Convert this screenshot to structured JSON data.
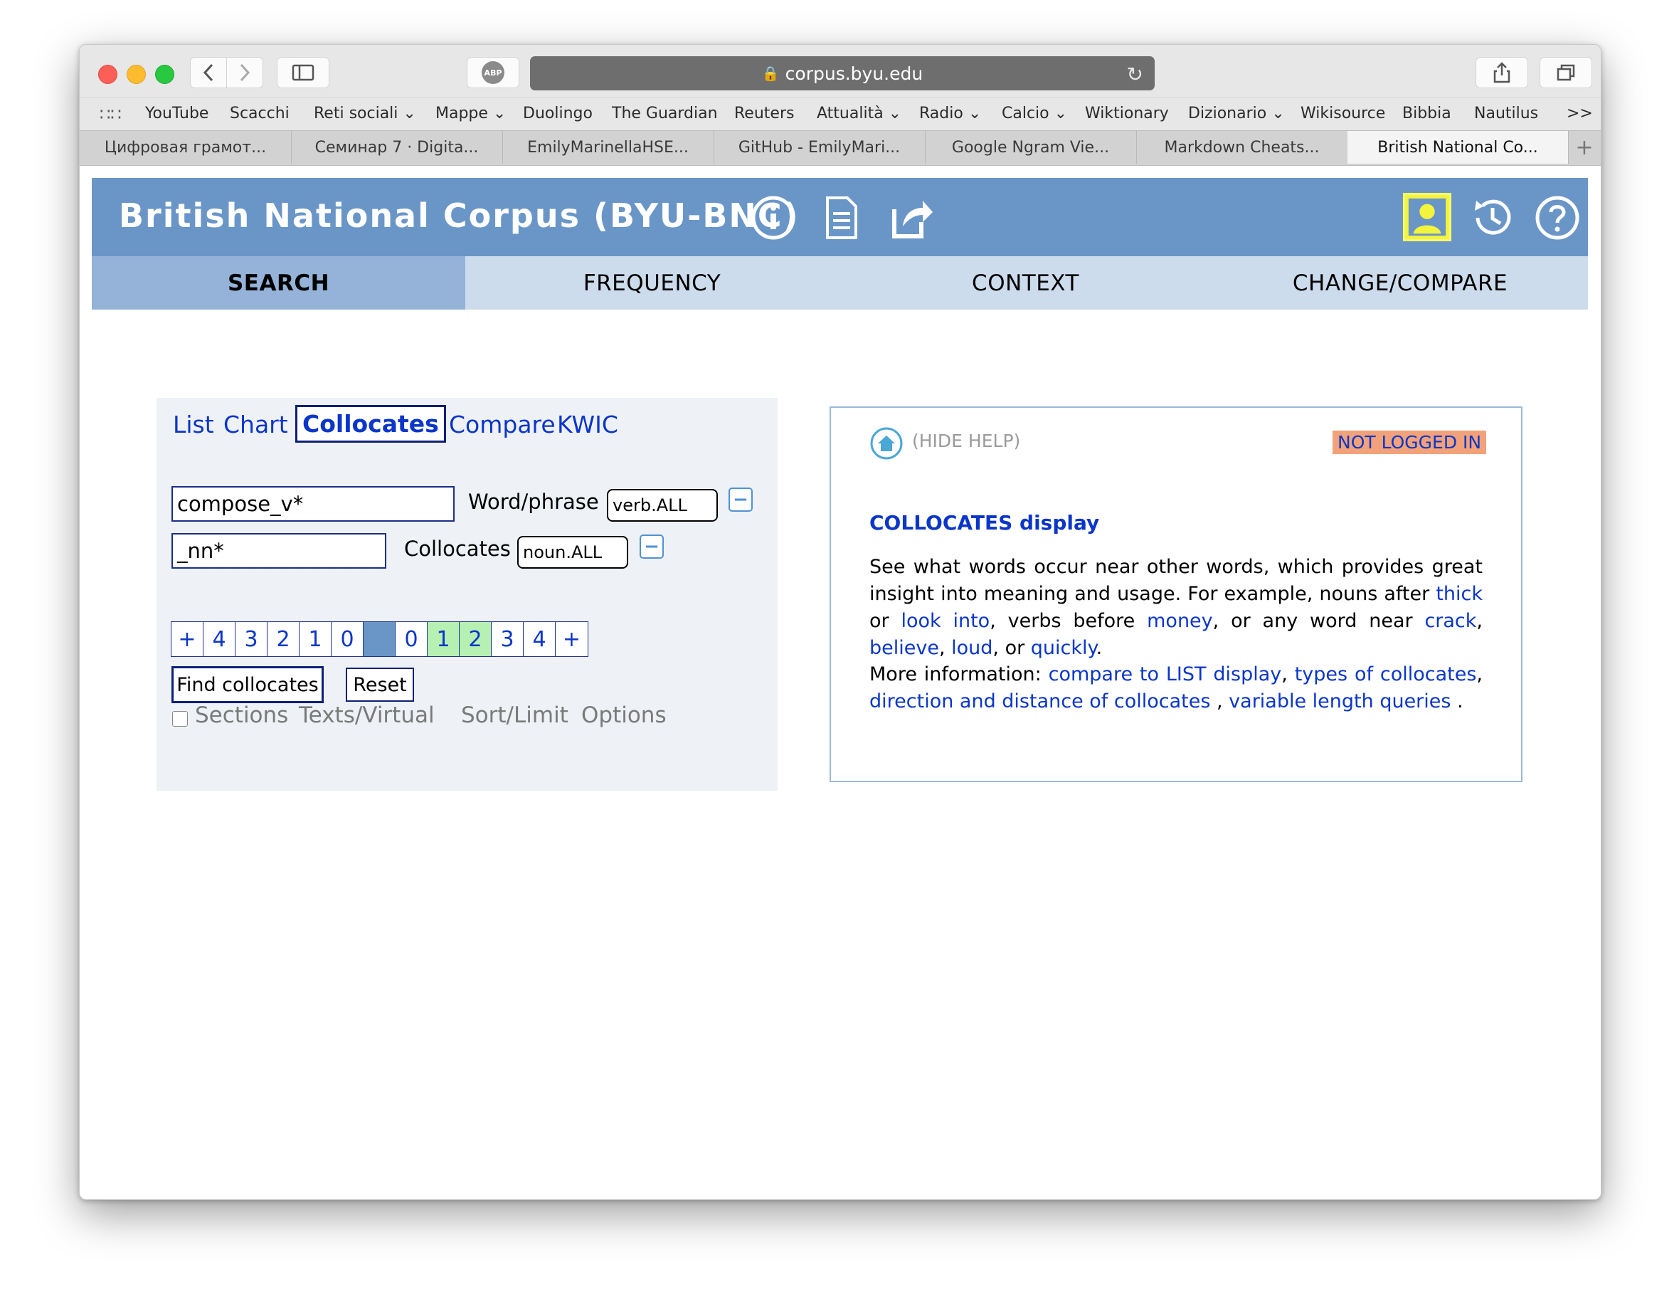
{
  "browser": {
    "url": "corpus.byu.edu",
    "adblock_label": "ABP",
    "bookmarks": [
      "YouTube",
      "Scacchi",
      "Reti sociali ⌄",
      "Mappe ⌄",
      "Duolingo",
      "The Guardian",
      "Reuters",
      "Attualità ⌄",
      "Radio ⌄",
      "Calcio ⌄",
      "Wiktionary",
      "Dizionario ⌄",
      "Wikisource",
      "Bibbia",
      "Nautilus"
    ],
    "bookmarks_overflow": ">>",
    "tabs": [
      "Цифровая грамот...",
      "Семинар 7 · Digita...",
      "EmilyMarinellaHSE...",
      "GitHub - EmilyMari...",
      "Google Ngram Vie...",
      "Markdown Cheats...",
      "British National Co..."
    ],
    "active_tab": 6,
    "new_tab_label": "+"
  },
  "header": {
    "title": "British National Corpus (BYU-BNC)",
    "icons": [
      "info-icon",
      "document-icon",
      "external-link-icon",
      "user-icon",
      "history-icon",
      "help-icon"
    ]
  },
  "nav": {
    "items": [
      "SEARCH",
      "FREQUENCY",
      "CONTEXT",
      "CHANGE/COMPARE"
    ],
    "active": 0
  },
  "search": {
    "modes": [
      "List",
      "Chart",
      "Collocates",
      "Compare",
      "KWIC"
    ],
    "active_mode": 2,
    "word_value": "compose_v*",
    "word_label": "Word/phrase",
    "word_pos": "verb.ALL",
    "collocate_value": "_nn*",
    "collocate_label": "Collocates",
    "collocate_pos": "noun.ALL",
    "minus_label": "−",
    "span": [
      "+",
      "4",
      "3",
      "2",
      "1",
      "0",
      "",
      "0",
      "1",
      "2",
      "3",
      "4",
      "+"
    ],
    "span_selected": [
      8,
      9
    ],
    "find_button": "Find collocates",
    "reset_button": "Reset",
    "sections_label": "Sections",
    "texts_label": "Texts/Virtual",
    "sort_label": "Sort/Limit",
    "options_label": "Options"
  },
  "help": {
    "hide_label": "(HIDE HELP)",
    "status_badge": "NOT LOGGED IN",
    "heading": "COLLOCATES display",
    "p1_a": "See what words occur near other words, which provides great insight into meaning and usage. For example, nouns after ",
    "p1_thick": "thick",
    "p1_or": " or ",
    "p1_lookinto": "look into",
    "p1_b": ", verbs before ",
    "p1_money": "money",
    "p1_c": ", or any word near ",
    "p1_crack": "crack",
    "p1_comma1": ", ",
    "p1_believe": "believe",
    "p1_comma2": ", ",
    "p1_loud": "loud",
    "p1_or2": ", or ",
    "p1_quickly": "quickly",
    "p1_end": ".",
    "p2_a": "More information: ",
    "p2_link1": "compare to LIST display",
    "p2_comma": ", ",
    "p2_link2": "types of collocates",
    "p2_comma2": ", ",
    "p2_link3": "direction and distance of collocates",
    "p2_sep": " , ",
    "p2_link4": "variable length queries",
    "p2_end": " ."
  }
}
